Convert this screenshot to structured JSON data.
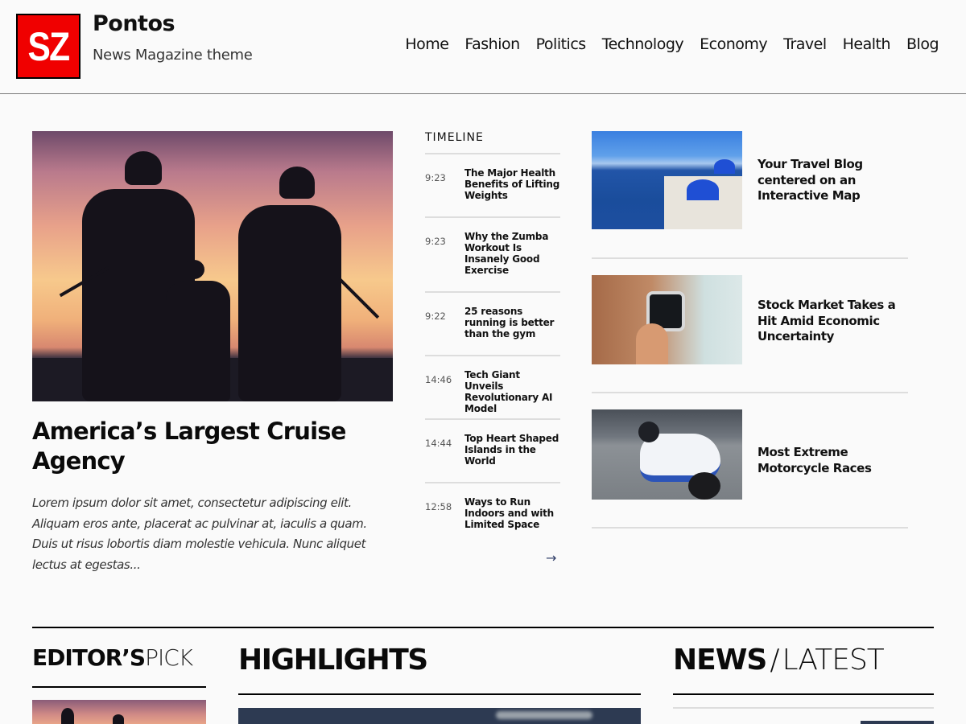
{
  "header": {
    "logo_text": "SZ",
    "logo_color": "#f00000",
    "site_title": "Pontos",
    "tagline": "News Magazine theme"
  },
  "nav": {
    "items": [
      "Home",
      "Fashion",
      "Politics",
      "Technology",
      "Economy",
      "Travel",
      "Health",
      "Blog"
    ]
  },
  "featured": {
    "image_alt": "Soldiers silhouetted against sunset",
    "title": "America’s Largest Cruise Agency",
    "excerpt": "Lorem ipsum dolor sit amet, consectetur adipiscing elit. Aliquam eros ante, placerat ac pulvinar at, iaculis a quam. Duis ut risus lobortis diam molestie vehicula. Nunc aliquet lectus at egestas..."
  },
  "timeline": {
    "title": "TIMELINE",
    "items": [
      {
        "time": "9:23",
        "headline": "The Major Health Benefits of Lifting Weights"
      },
      {
        "time": "9:23",
        "headline": "Why the Zumba Workout Is Insanely Good Exercise"
      },
      {
        "time": "9:22",
        "headline": "25 reasons running is better than the gym"
      },
      {
        "time": "14:46",
        "headline": "Tech Giant Unveils Revolutionary AI Model"
      },
      {
        "time": "14:44",
        "headline": "Top Heart Shaped Islands in the World"
      },
      {
        "time": "12:58",
        "headline": "Ways to Run Indoors and with Limited Space"
      }
    ],
    "more_icon": "arrow-right-icon",
    "more_glyph": "→"
  },
  "side_articles": [
    {
      "headline": "Your Travel Blog centered on an Interactive Map",
      "image": "Santorini blue domes"
    },
    {
      "headline": "Stock Market Takes a Hit Amid Economic Uncertainty",
      "image": "Smartwatch on wrist"
    },
    {
      "headline": "Most Extreme Motorcycle Races",
      "image": "Motorcycle racer cornering"
    }
  ],
  "sections": {
    "editors_pick": {
      "bold": "EDITOR’S",
      "light": "PICK"
    },
    "highlights": {
      "title": "HIGHLIGHTS"
    },
    "news_latest": {
      "bold": "NEWS",
      "slash": "/",
      "light": "LATEST"
    }
  }
}
